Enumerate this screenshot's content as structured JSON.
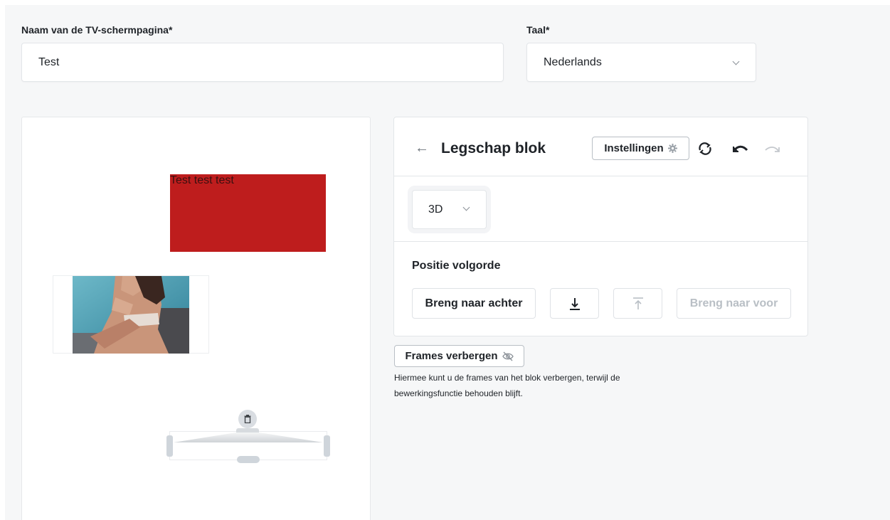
{
  "form": {
    "name_label": "Naam van de TV-schermpagina*",
    "name_value": "Test",
    "lang_label": "Taal*",
    "lang_value": "Nederlands"
  },
  "canvas": {
    "text_block": "Test test test",
    "text_block_color": "#be1d1d"
  },
  "panel": {
    "title": "Legschap blok",
    "back_icon": "arrow-left-icon",
    "settings_label": "Instellingen",
    "mode_value": "3D",
    "position_title": "Positie volgorde",
    "send_back_label": "Breng naar achter",
    "bring_front_label": "Breng naar voor"
  },
  "frames": {
    "button_label": "Frames verbergen",
    "help_text": "Hiermee kunt u de frames van het blok verbergen, terwijl de bewerkingsfunctie behouden blijft."
  }
}
